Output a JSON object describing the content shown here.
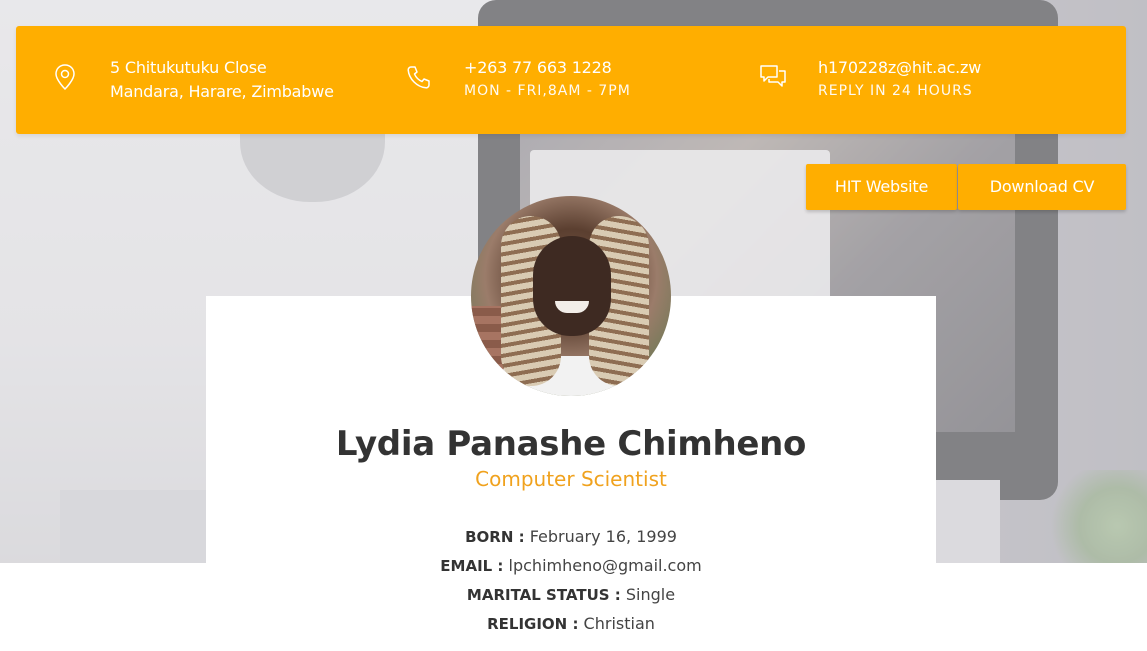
{
  "contact": {
    "address_line1": "5 Chitukutuku Close",
    "address_line2": "Mandara, Harare, Zimbabwe",
    "phone": "+263 77 663 1228",
    "hours": "MON - FRI,8AM - 7PM",
    "email": "h170228z@hit.ac.zw",
    "reply": "REPLY IN 24 HOURS",
    "icons": [
      "location-pin-icon",
      "phone-icon",
      "chat-icon"
    ]
  },
  "buttons": {
    "hit_website": "HIT Website",
    "download_cv": "Download CV"
  },
  "profile": {
    "name": "Lydia Panashe Chimheno",
    "role": "Computer Scientist",
    "born_label": "BORN :",
    "born_value": "February 16, 1999",
    "email_label": "EMAIL :",
    "email_value": "lpchimheno@gmail.com",
    "marital_label": "MARITAL STATUS :",
    "marital_value": "Single",
    "religion_label": "RELIGION :",
    "religion_value": "Christian"
  },
  "colors": {
    "accent": "#ffae00",
    "role_text": "#f0a21e",
    "name_text": "#333333"
  }
}
